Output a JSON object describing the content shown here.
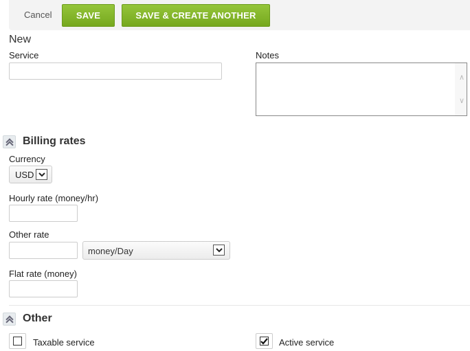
{
  "toolbar": {
    "cancel_label": "Cancel",
    "save_label": "SAVE",
    "save_create_another_label": "SAVE & CREATE ANOTHER",
    "button_color": "#86b72c",
    "background_color": "#f3f3f3"
  },
  "form": {
    "title": "New",
    "service": {
      "label": "Service",
      "value": "",
      "placeholder": ""
    },
    "notes": {
      "label": "Notes",
      "value": ""
    }
  },
  "billing_rates": {
    "title": "Billing rates",
    "toggle_icon": "chevron-double-up-icon",
    "currency": {
      "label": "Currency",
      "selected": "USD"
    },
    "hourly_rate": {
      "label": "Hourly rate (money/hr)",
      "value": ""
    },
    "other_rate": {
      "label": "Other rate",
      "value": "",
      "unit_selected": "money/Day"
    },
    "flat_rate": {
      "label": "Flat rate (money)",
      "value": ""
    }
  },
  "other": {
    "title": "Other",
    "toggle_icon": "chevron-double-up-icon",
    "taxable_service": {
      "label": "Taxable service",
      "checked": false
    },
    "active_service": {
      "label": "Active service",
      "checked": true
    }
  }
}
